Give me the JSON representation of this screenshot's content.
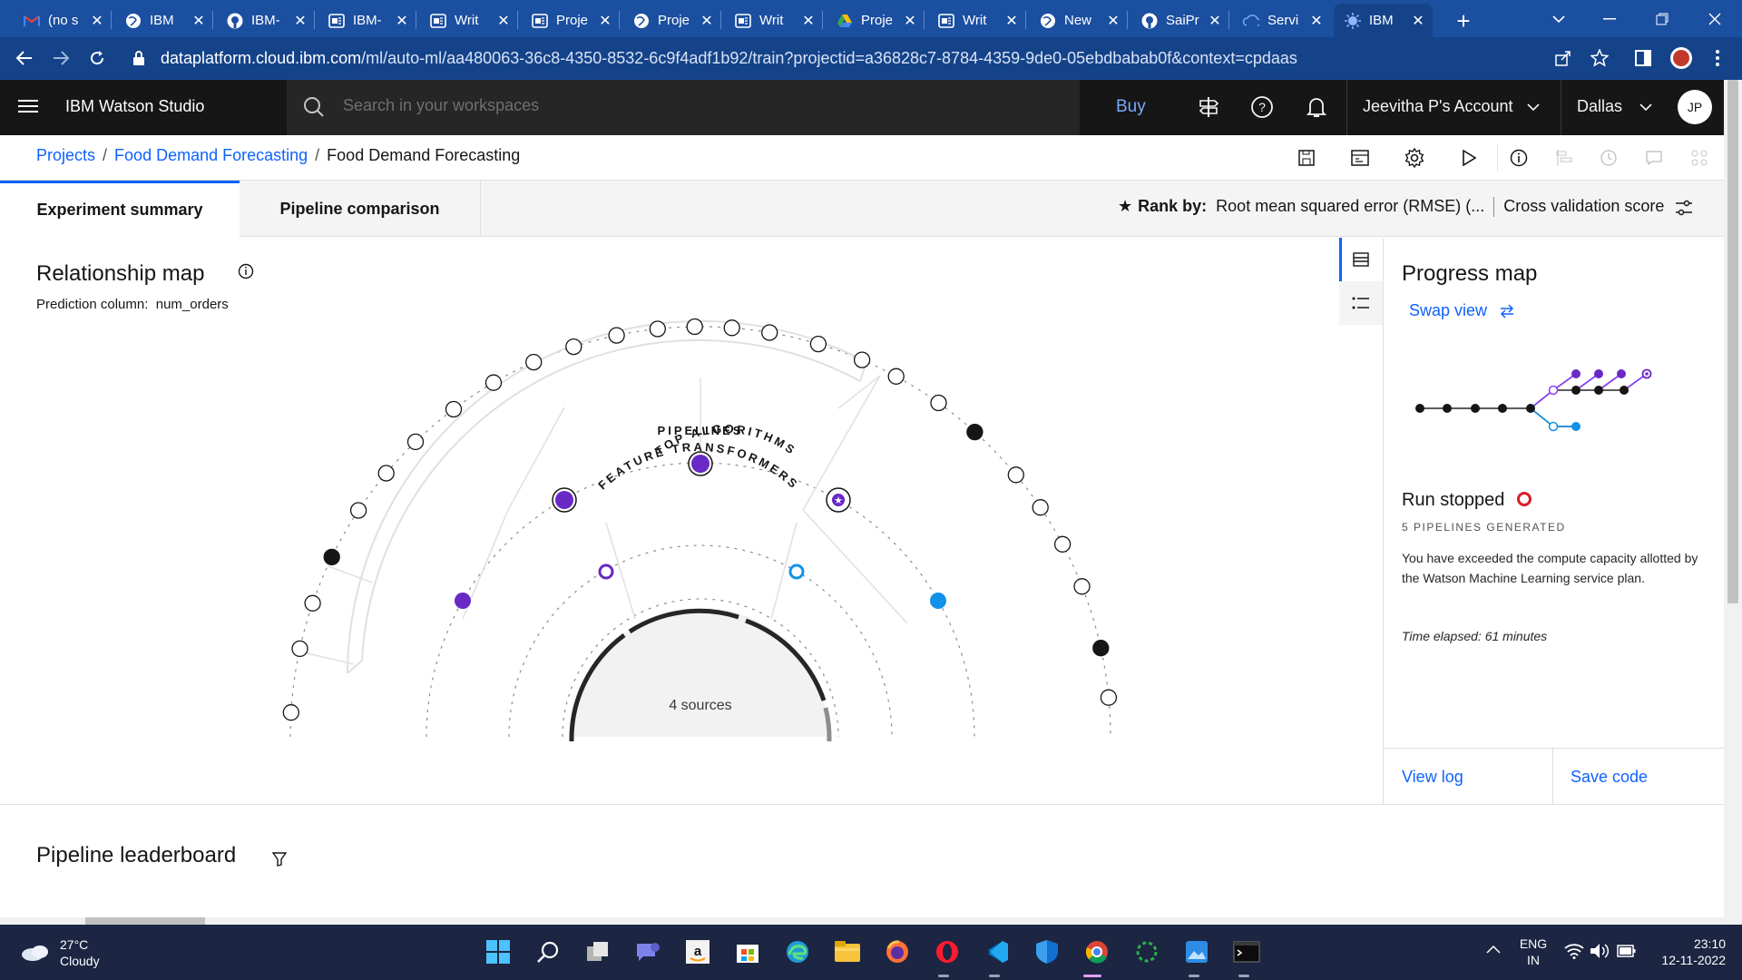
{
  "browser": {
    "tabs": [
      {
        "label": "(no s",
        "icon": "gmail-icon"
      },
      {
        "label": "IBM",
        "icon": "globe-icon"
      },
      {
        "label": "IBM-",
        "icon": "github-icon"
      },
      {
        "label": "IBM-",
        "icon": "doc-icon"
      },
      {
        "label": "Writ",
        "icon": "doc-icon"
      },
      {
        "label": "Proje",
        "icon": "doc-icon"
      },
      {
        "label": "Proje",
        "icon": "globe-icon"
      },
      {
        "label": "Writ",
        "icon": "doc-icon"
      },
      {
        "label": "Proje",
        "icon": "drive-icon"
      },
      {
        "label": "Writ",
        "icon": "doc-icon"
      },
      {
        "label": "New",
        "icon": "globe-icon"
      },
      {
        "label": "SaiPr",
        "icon": "github-icon"
      },
      {
        "label": "Servi",
        "icon": "cloud-icon"
      },
      {
        "label": "IBM",
        "icon": "ibm-icon",
        "active": true
      }
    ],
    "url_domain": "dataplatform.cloud.ibm.com",
    "url_path": "/ml/auto-ml/aa480063-36c8-4350-8532-6c9f4adf1b92/train?projectid=a36828c7-8784-4359-9de0-05ebdbabab0f&context=cpdaas"
  },
  "header": {
    "brand": "IBM Watson Studio",
    "search_placeholder": "Search in your workspaces",
    "buy": "Buy",
    "account": "Jeevitha P's Account",
    "region": "Dallas",
    "avatar_initials": "JP"
  },
  "breadcrumb": {
    "projects": "Projects",
    "project": "Food Demand Forecasting",
    "current": "Food Demand Forecasting"
  },
  "tabs": {
    "summary": "Experiment summary",
    "comparison": "Pipeline comparison"
  },
  "rank": {
    "label": "Rank by:",
    "metric": "Root mean squared error (RMSE) (...",
    "score": "Cross validation score"
  },
  "relationship_map": {
    "title": "Relationship map",
    "prediction_label": "Prediction column:",
    "prediction_value": "num_orders",
    "ring_feature": "FEATURE TRANSFORMERS",
    "ring_pipelines": "PIPELINES",
    "ring_algorithms": "TOP ALGORITHMS",
    "center": "4 sources"
  },
  "progress": {
    "title": "Progress map",
    "swap": "Swap view",
    "status": "Run stopped",
    "pipelines": "5 PIPELINES GENERATED",
    "message": "You have exceeded the compute capacity allotted by the Watson Machine Learning service plan.",
    "elapsed": "Time elapsed: 61 minutes",
    "view_log": "View log",
    "save_code": "Save code"
  },
  "leaderboard": {
    "title": "Pipeline leaderboard"
  },
  "colors": {
    "accent": "#0f62fe",
    "purple": "#6929c4",
    "cyan": "#1192e8",
    "stopped": "#da1e28"
  },
  "taskbar": {
    "temperature": "27°C",
    "weather": "Cloudy",
    "lang1": "ENG",
    "lang2": "IN",
    "time": "23:10",
    "date": "12-11-2022"
  }
}
